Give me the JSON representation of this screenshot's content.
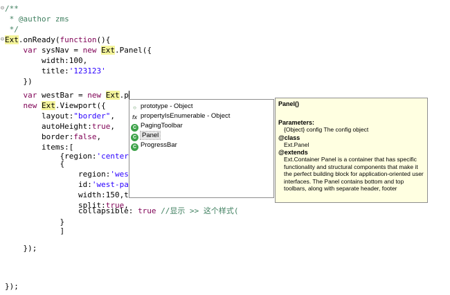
{
  "editor": {
    "lines": [
      {
        "text": "/**"
      },
      {
        "text": " * @author zms"
      },
      {
        "text": " */"
      },
      {
        "p1": "Ext",
        "p2": ".onReady(",
        "p3": "function",
        "p4": "(){"
      },
      {
        "i": "    ",
        "kw": "var",
        "a": " sysNav = ",
        "kw2": "new",
        "b": " ",
        "ext": "Ext",
        "c": ".Panel({"
      },
      {
        "text": "        width:100,"
      },
      {
        "a": "        title:",
        "s": "'123123'"
      },
      {
        "text": "    })"
      },
      {
        "text": ""
      },
      {
        "i": "    ",
        "kw": "var",
        "a": " westBar = ",
        "kw2": "new",
        "b": " ",
        "ext": "Ext",
        "c": ".p"
      },
      {
        "i": "    ",
        "kw": "new",
        "a": " ",
        "ext": "Ext",
        "c": ".Viewport({"
      },
      {
        "a": "        layout:",
        "s": "\"border\"",
        "c": ","
      },
      {
        "a": "        autoHeight:",
        "kw": "true",
        "c": ","
      },
      {
        "a": "        border:",
        "kw": "false",
        "c": ","
      },
      {
        "text": "        items:["
      },
      {
        "a": "            {region:",
        "s": "'center"
      },
      {
        "text": "            {"
      },
      {
        "a": "                region:",
        "s": "'wes"
      },
      {
        "a": "                id:",
        "s": "'west-pa"
      },
      {
        "text": "                width:150,t"
      },
      {
        "a": "                split:",
        "kw": "true",
        "c": ","
      },
      {
        "a": "                collapsible: ",
        "kw": "true",
        "c": " ",
        "cm": "//显示 >> 这个样式("
      },
      {
        "text": "            }"
      },
      {
        "text": "            ]"
      },
      {
        "text": ""
      },
      {
        "text": "    });"
      },
      {
        "text": ""
      },
      {
        "text": ""
      },
      {
        "text": ""
      },
      {
        "text": "});"
      }
    ]
  },
  "completion": {
    "items": [
      {
        "label": "prototype - Object",
        "icon": "field-icon"
      },
      {
        "label": "propertyIsEnumerable - Object",
        "icon": "function-icon"
      },
      {
        "label": "PagingToolbar",
        "icon": "class-icon"
      },
      {
        "label": "Panel",
        "icon": "class-icon"
      },
      {
        "label": "ProgressBar",
        "icon": "class-icon"
      }
    ],
    "selected_index": 3,
    "fx_glyph": "fx",
    "class_glyph": "C"
  },
  "doc": {
    "title": "Panel()",
    "params_heading": "Parameters:",
    "param": "{Object} config  The config object",
    "class_heading": "@class",
    "class_value": "Ext.Panel",
    "extends_heading": "@extends",
    "description": "Ext.Container Panel is a container that has specific functionality and structural components that make it the perfect building block for application-oriented user interfaces. The Panel contains bottom and top toolbars, along with separate header, footer"
  },
  "colors": {
    "comment": "#3f7f5f",
    "keyword": "#7f0055",
    "string": "#2a00ff",
    "highlight": "#f4f49b",
    "doc_background": "#ffffe1"
  }
}
